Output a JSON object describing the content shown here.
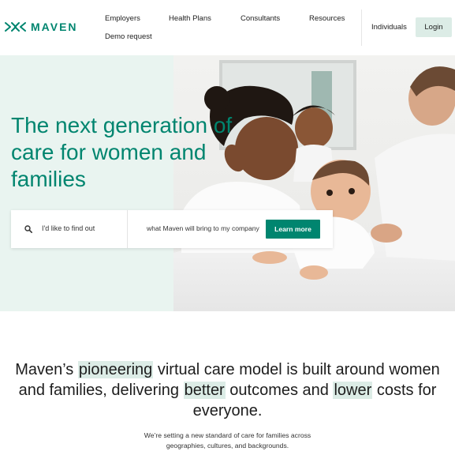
{
  "brand": {
    "name": "MAVEN",
    "accent": "#00856f",
    "mint": "#e9f4f0",
    "highlight": "#dcece6"
  },
  "nav": {
    "items": [
      "Employers",
      "Health Plans",
      "Consultants",
      "Resources",
      "Demo request"
    ],
    "individuals": "Individuals",
    "login": "Login"
  },
  "hero": {
    "title": "The next generation of care for women and families",
    "search_prefix": "I'd like to find out",
    "search_value": "what Maven will bring to my company",
    "cta": "Learn more"
  },
  "mission": {
    "part1": "Maven’s ",
    "hl1": "pioneering",
    "part2": " virtual care model is built around women and families, delivering ",
    "hl2": "better",
    "part3": " outcomes and ",
    "hl3": "lower",
    "part4": " costs for everyone.",
    "sub_line1": "We’re setting a new standard of care for families across",
    "sub_line2": "geographies, cultures, and backgrounds."
  },
  "icons": {
    "logo": "maven-logo-icon",
    "search": "search-icon"
  }
}
